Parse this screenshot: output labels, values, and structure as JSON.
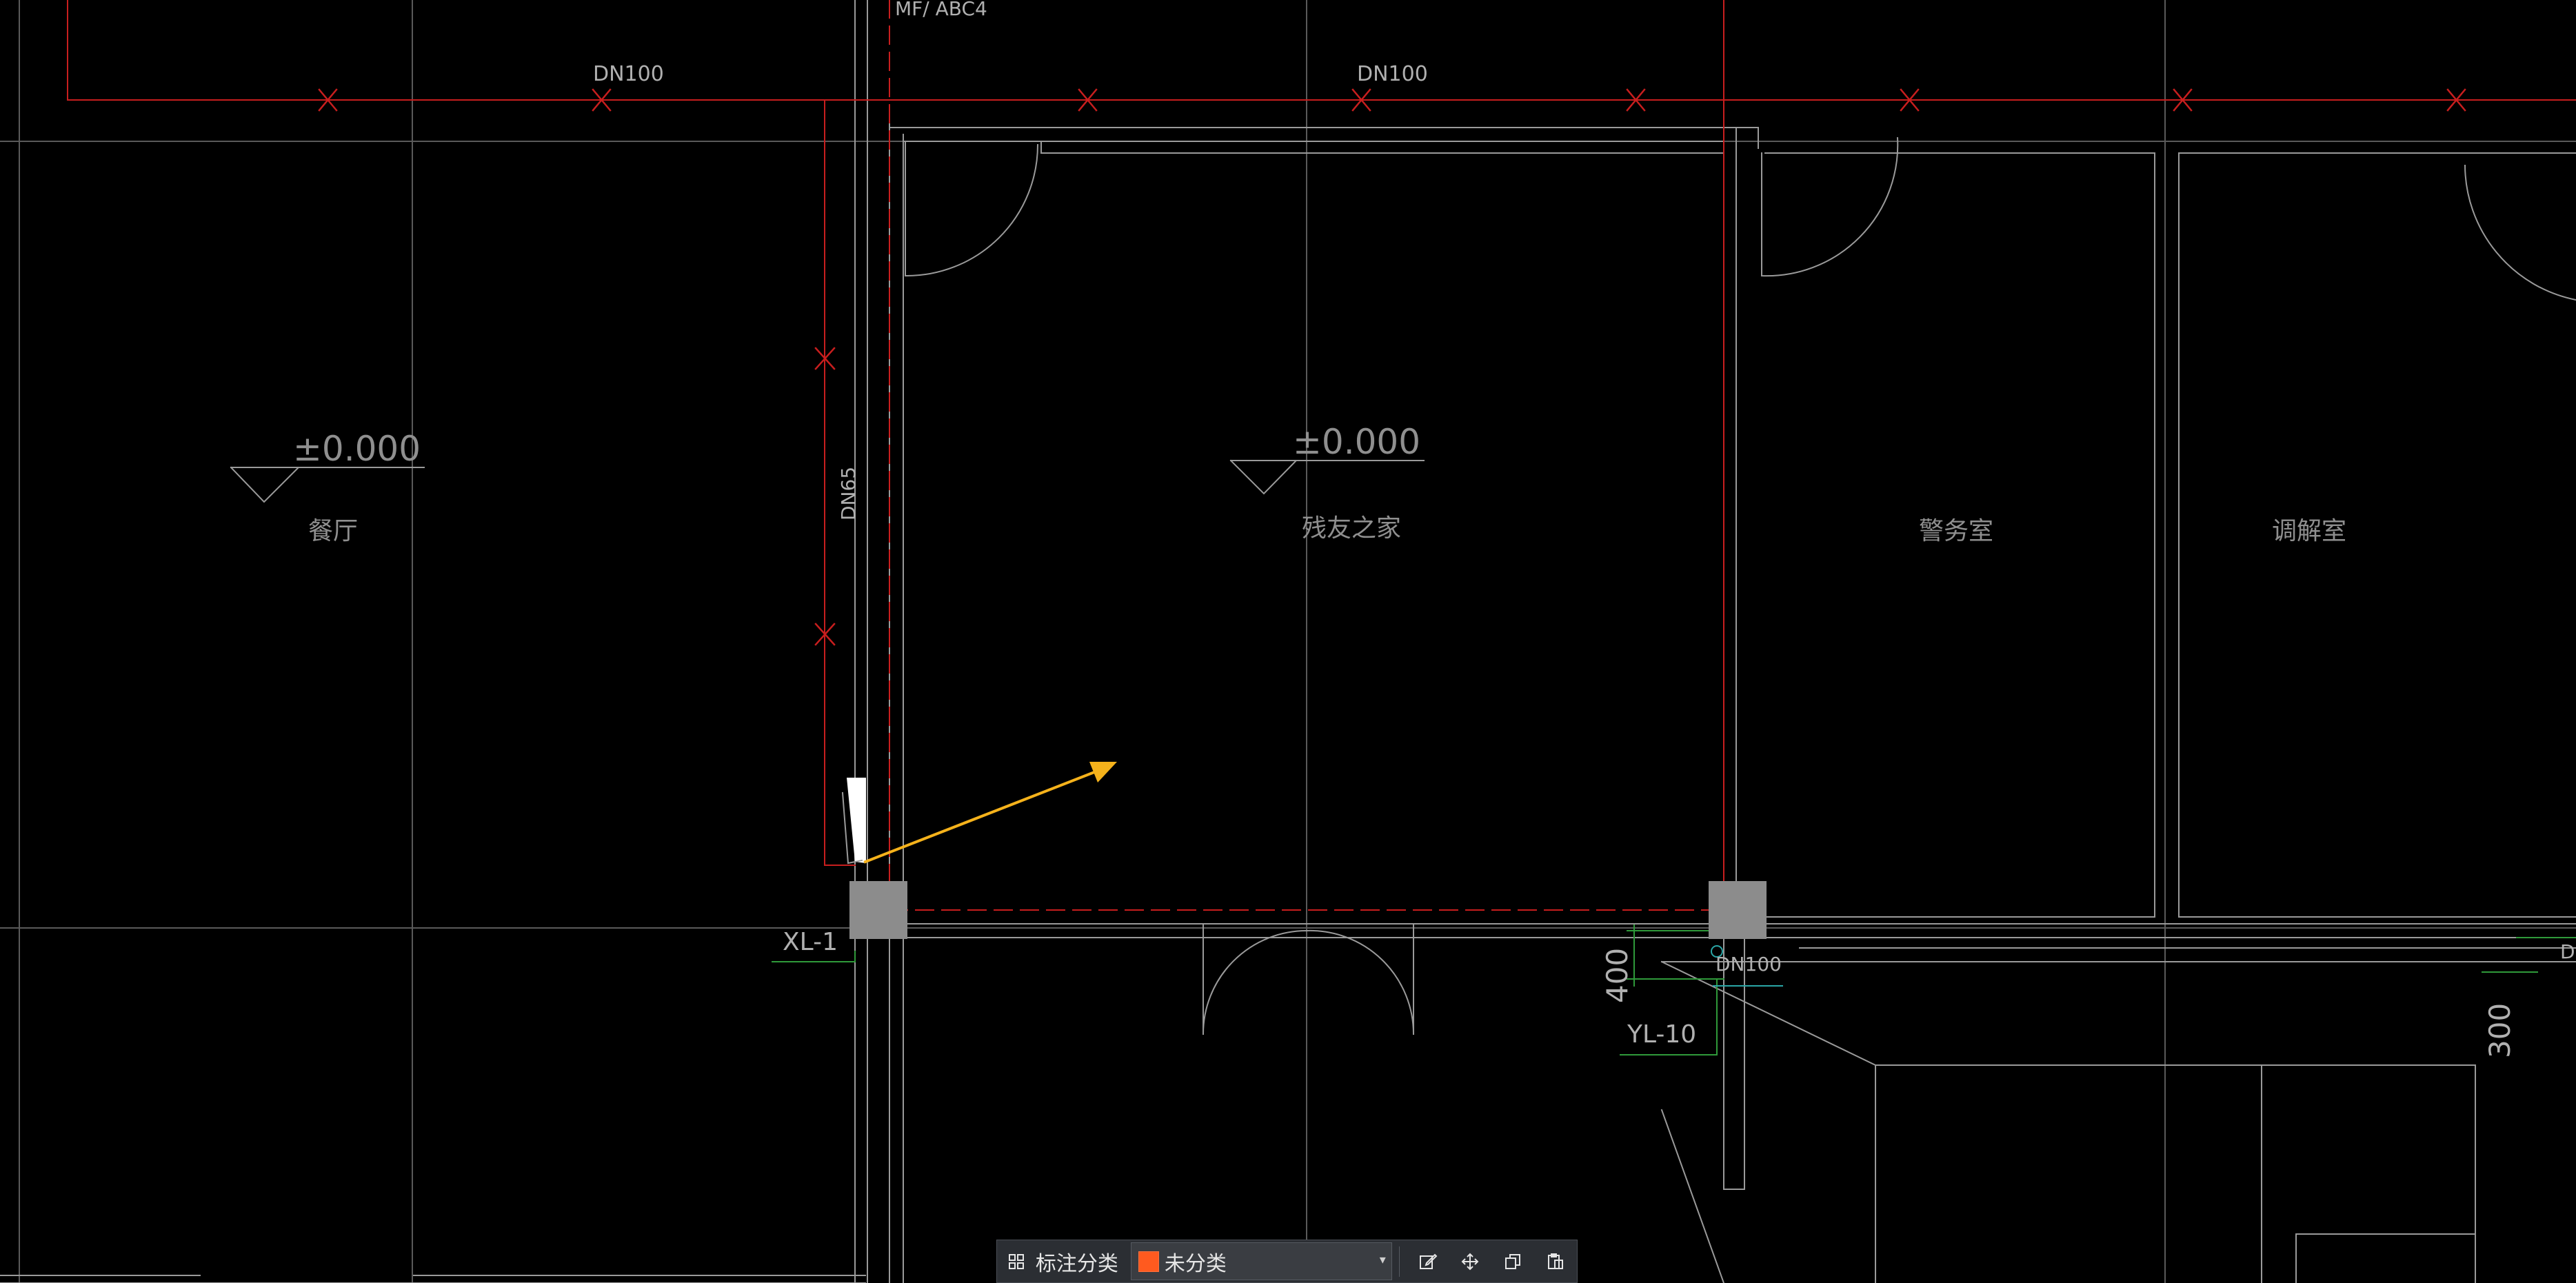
{
  "drawing": {
    "pipe_labels": {
      "dn100_a": "DN100",
      "dn100_b": "DN100",
      "dn65": "DN65",
      "dn100_c": "DN100",
      "mf_abc4": "MF/ ABC4",
      "dn_partial": "D"
    },
    "rooms": {
      "canteen": "餐厅",
      "disabled_home": "残友之家",
      "police_room": "警务室",
      "mediation_room": "调解室"
    },
    "elevations": {
      "left": "±0.000",
      "center": "±0.000"
    },
    "tags": {
      "xl1": "XL-1",
      "yl10": "YL-10"
    },
    "dimensions": {
      "d400": "400",
      "d300": "300"
    },
    "colors": {
      "pipe_red": "#c81e1e",
      "wall_gray": "#9a9a9a",
      "dim_green": "#2f9a3a",
      "arrow_yellow": "#f5b21b",
      "column_gray": "#8c8c8c"
    }
  },
  "toolbar": {
    "category_label": "标注分类",
    "category_value": "未分类",
    "swatch_color": "#ff5a1f",
    "icons": [
      "grid-icon",
      "edit-icon",
      "move-icon",
      "copy-icon",
      "paste-icon"
    ]
  }
}
